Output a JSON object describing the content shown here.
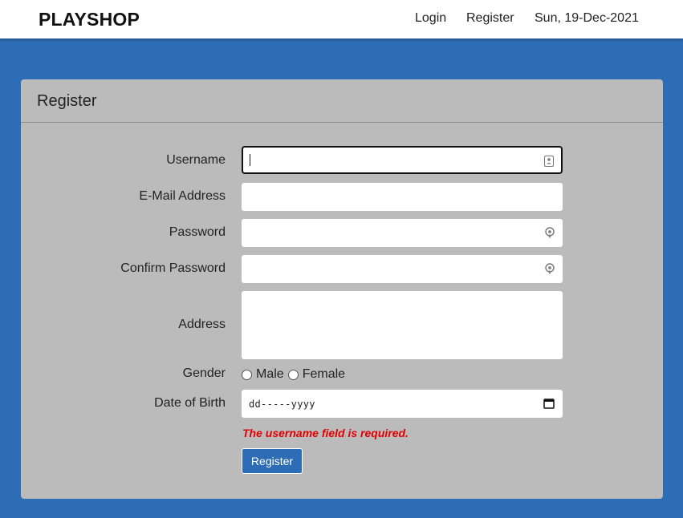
{
  "navbar": {
    "brand": "PLAYSHOP",
    "login_label": "Login",
    "register_label": "Register",
    "date": "Sun, 19-Dec-2021"
  },
  "form": {
    "title": "Register",
    "fields": {
      "username_label": "Username",
      "username_value": "",
      "email_label": "E-Mail Address",
      "email_value": "",
      "password_label": "Password",
      "password_value": "",
      "confirm_password_label": "Confirm Password",
      "confirm_password_value": "",
      "address_label": "Address",
      "address_value": "",
      "gender_label": "Gender",
      "gender_options": [
        "Male",
        "Female"
      ],
      "dob_label": "Date of Birth",
      "dob_placeholder": "dd-----yyyy"
    },
    "error_message": "The username field is required.",
    "submit_label": "Register"
  },
  "colors": {
    "background": "#2d6db5",
    "card": "#bbbbbb",
    "error": "#e00000",
    "button": "#2d6db5"
  },
  "icons": {
    "username": "contact-card-icon",
    "password": "key-icon",
    "confirm_password": "key-icon",
    "dob": "calendar-icon"
  }
}
